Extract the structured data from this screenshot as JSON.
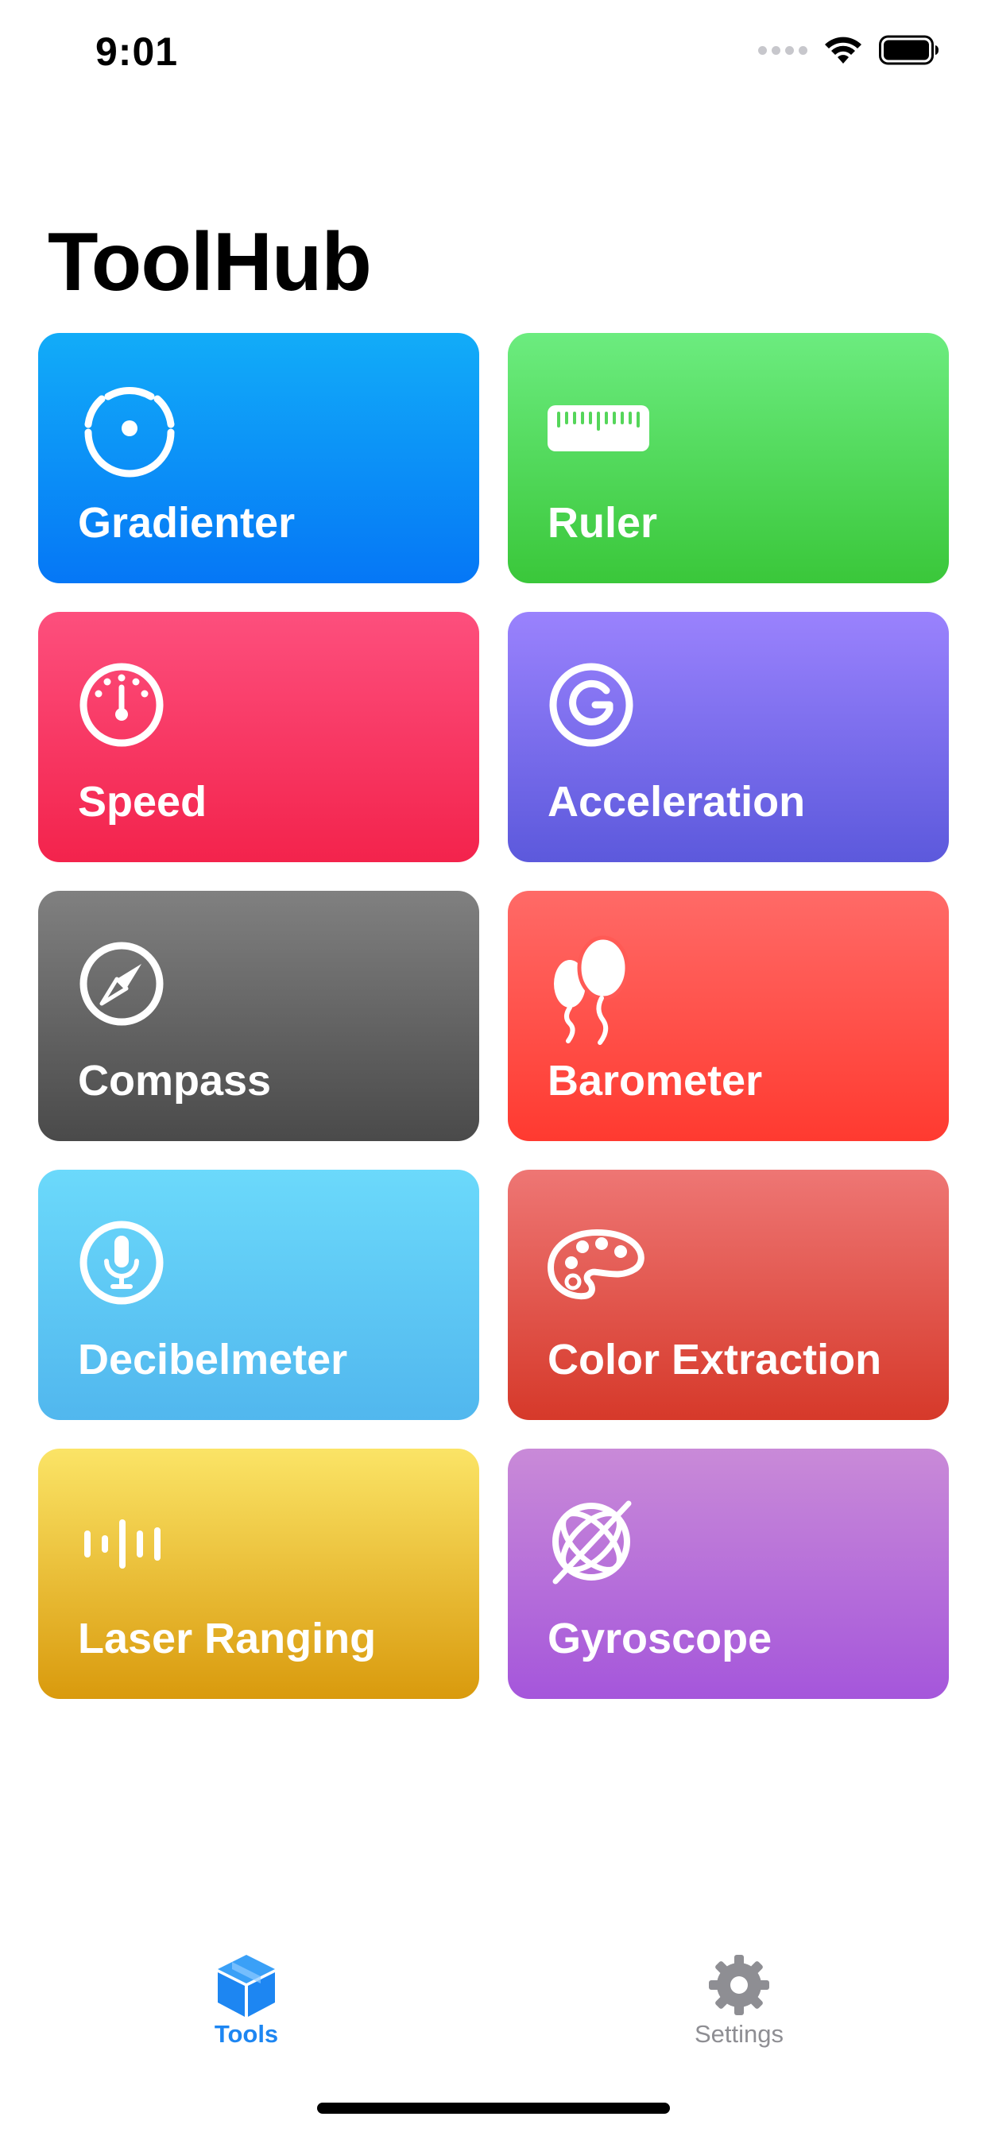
{
  "status_bar": {
    "time": "9:01",
    "icons": [
      "signal-dots-icon",
      "wifi-icon",
      "battery-icon"
    ]
  },
  "app_title": "ToolHub",
  "tiles": [
    {
      "label": "Gradienter",
      "icon": "level-icon",
      "color_top": "#12acf8",
      "color_bottom": "#0577f6"
    },
    {
      "label": "Ruler",
      "icon": "ruler-icon",
      "color_top": "#6cec7f",
      "color_bottom": "#3ac73a"
    },
    {
      "label": "Speed",
      "icon": "speedometer-icon",
      "color_top": "#fd4f7d",
      "color_bottom": "#f3234c"
    },
    {
      "label": "Acceleration",
      "icon": "g-force-icon",
      "color_top": "#9a82fd",
      "color_bottom": "#5c59dc"
    },
    {
      "label": "Compass",
      "icon": "compass-icon",
      "color_top": "#808080",
      "color_bottom": "#4a4a4a"
    },
    {
      "label": "Barometer",
      "icon": "balloons-icon",
      "color_top": "#ff6a67",
      "color_bottom": "#ff3a30"
    },
    {
      "label": "Decibelmeter",
      "icon": "microphone-icon",
      "color_top": "#6bd9fb",
      "color_bottom": "#51b7ee"
    },
    {
      "label": "Color Extraction",
      "icon": "palette-icon",
      "color_top": "#ee7674",
      "color_bottom": "#d6392a"
    },
    {
      "label": "Laser Ranging",
      "icon": "waveform-icon",
      "color_top": "#fbe466",
      "color_bottom": "#d99a0d"
    },
    {
      "label": "Gyroscope",
      "icon": "gyroscope-icon",
      "color_top": "#c98ad8",
      "color_bottom": "#a556db"
    }
  ],
  "tab_bar": {
    "tabs": [
      {
        "label": "Tools",
        "icon": "cube-icon",
        "selected": true,
        "color": "#1d86f2"
      },
      {
        "label": "Settings",
        "icon": "gear-icon",
        "selected": false,
        "color": "#8e8e93"
      }
    ]
  }
}
